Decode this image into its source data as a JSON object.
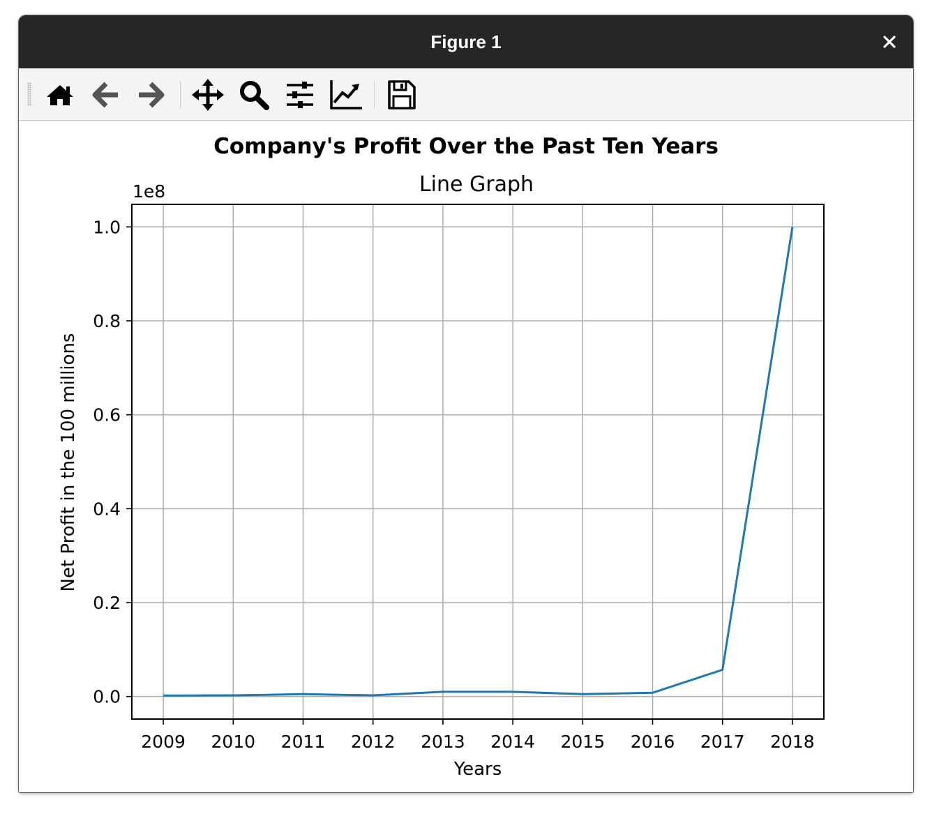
{
  "window": {
    "title": "Figure 1"
  },
  "toolbar": {
    "buttons": [
      {
        "icon": "home-icon"
      },
      {
        "icon": "back-arrow-icon"
      },
      {
        "icon": "forward-arrow-icon"
      },
      {
        "icon": "pan-move-icon"
      },
      {
        "icon": "zoom-magnifier-icon"
      },
      {
        "icon": "subplots-config-icon"
      },
      {
        "icon": "edit-axis-icon"
      },
      {
        "icon": "save-floppy-icon"
      }
    ]
  },
  "chart_data": {
    "type": "line",
    "title": "Company's Profit Over the Past Ten Years",
    "subtitle": "Line Graph",
    "xlabel": "Years",
    "ylabel": "Net Profit in the 100 millions",
    "offset_text": "1e8",
    "x": [
      2009,
      2010,
      2011,
      2012,
      2013,
      2014,
      2015,
      2016,
      2017,
      2018
    ],
    "y": [
      200000,
      250000,
      500000,
      250000,
      1000000,
      1000000,
      500000,
      800000,
      5700000,
      100000000
    ],
    "ylim": [
      -4800000,
      104800000
    ],
    "xlim": [
      2008.55,
      2018.45
    ],
    "yticks": [
      0,
      20000000,
      40000000,
      60000000,
      80000000,
      100000000
    ],
    "ytick_labels": [
      "0.0",
      "0.2",
      "0.4",
      "0.6",
      "0.8",
      "1.0"
    ],
    "xtick_labels": [
      "2009",
      "2010",
      "2011",
      "2012",
      "2013",
      "2014",
      "2015",
      "2016",
      "2017",
      "2018"
    ],
    "grid": true,
    "line_color": "#1f77b4"
  }
}
